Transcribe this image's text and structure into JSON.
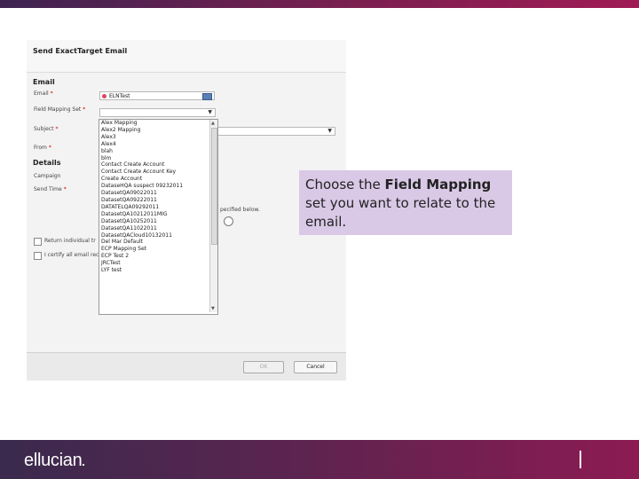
{
  "dialog": {
    "title": "Send ExactTarget Email",
    "section_email": "Email",
    "section_details": "Details",
    "labels": {
      "email": "Email",
      "field_mapping_set": "Field Mapping Set",
      "subject": "Subject",
      "from": "From",
      "campaign": "Campaign",
      "send_time": "Send Time",
      "required_marker": "*"
    },
    "email_value": "ELNTest",
    "send_time_suffix": "pecified below.",
    "checkbox_return_individual": "Return individual tr",
    "checkbox_certify": "I certify all email rec",
    "dropdown_items": [
      "Alex Mapping",
      "Alex2 Mapping",
      "Alex3",
      "Alex4",
      "blah",
      "blm",
      "Contact Create Account",
      "Contact Create Account Key",
      "Create Account",
      "DataseHQA suspect 09232011",
      "DatasetQA09022011",
      "DatasetQA09222011",
      "DATATELQA09292011",
      "DatasetQA10212011MIG",
      "DatasetQA10252011",
      "DatasetQA11022011",
      "DatasetQACloud10132011",
      "Del Mar Default",
      "ECP Mapping Set",
      "ECP Test 2",
      "JRCTest",
      "LYF test"
    ],
    "buttons": {
      "ok": "OK",
      "cancel": "Cancel"
    }
  },
  "callout": {
    "text_before": "Choose the ",
    "text_bold": "Field Mapping",
    "text_after": " set you want to relate to the email."
  },
  "footer": {
    "logo_text": "ellucian"
  },
  "colors": {
    "callout_bg": "#d9c8e6",
    "band_left": "#3a2a4d",
    "band_right": "#8c1b52"
  }
}
